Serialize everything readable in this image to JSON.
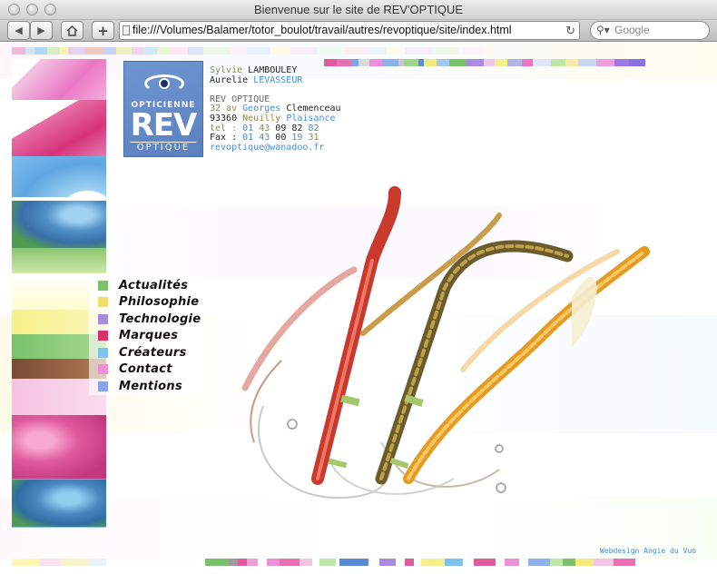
{
  "window": {
    "title": "Bienvenue sur le site de REV'OPTIQUE"
  },
  "toolbar": {
    "back_icon": "back-arrow-icon",
    "forward_icon": "forward-arrow-icon",
    "home_icon": "home-icon",
    "add_icon": "plus-icon",
    "url": "file:///Volumes/Balamer/totor_boulot/travail/autres/revoptique/site/index.html",
    "search_placeholder": "Google"
  },
  "logo": {
    "top_text": "OPTICIENNE",
    "main_text": "REV",
    "bottom_text": "OPTIQUE"
  },
  "info": {
    "name1_first": "Sylvie",
    "name1_last": "LAMBOULEY",
    "name2_first": "Aurelie",
    "name2_last": "LEVASSEUR",
    "company": "REV OPTIQUE",
    "addr_num": "32 av",
    "addr_street1": "Georges",
    "addr_street2": "Clemenceau",
    "addr_zip": "93360",
    "addr_city1": "Neuilly",
    "addr_city2": "Plaisance",
    "tel_label": "tel :",
    "tel_parts": [
      "01",
      "43",
      "09",
      "82",
      "82"
    ],
    "fax_label": "Fax :",
    "fax_parts": [
      "01",
      "43",
      "00",
      "19",
      "31"
    ],
    "email": "revoptique@wanadoo.fr"
  },
  "nav": {
    "items": [
      {
        "label": "Actualités",
        "color": "#7ac36a"
      },
      {
        "label": "Philosophie",
        "color": "#f2de6a"
      },
      {
        "label": "Technologie",
        "color": "#a78be0"
      },
      {
        "label": "Marques",
        "color": "#d6336c"
      },
      {
        "label": "Créateurs",
        "color": "#7cc4ef"
      },
      {
        "label": "Contact",
        "color": "#ef8ed8"
      },
      {
        "label": "Mentions",
        "color": "#8aa4e6"
      }
    ]
  },
  "footer": {
    "credit": "Webdesign Angie du Vuo"
  },
  "colors": {
    "pink": "#e84d9e",
    "blue": "#5aa7e0",
    "green": "#7ac36a",
    "yellow": "#f8ec6a",
    "purple": "#8c6fe0",
    "brand_blue": "#6f95d1"
  }
}
